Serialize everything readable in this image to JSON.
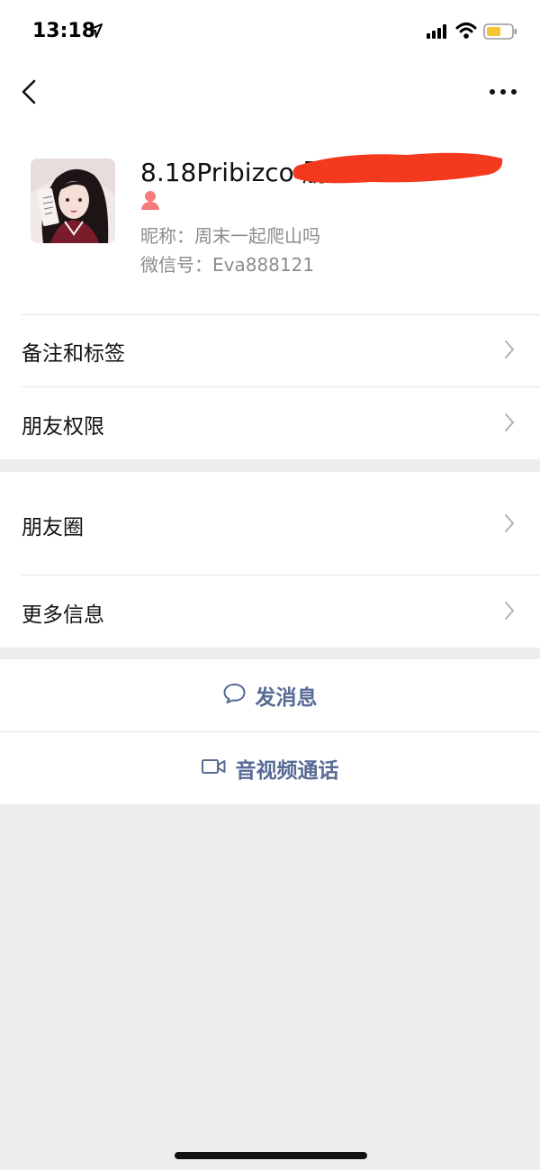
{
  "status_bar": {
    "time": "13:18"
  },
  "profile": {
    "display_name": "8.18Pribizco 朋",
    "nickname": "昵称：周末一起爬山吗",
    "wechat_id": "微信号：Eva888121"
  },
  "menu": {
    "remarks_tags": "备注和标签",
    "friend_permissions": "朋友权限",
    "moments": "朋友圈",
    "more_info": "更多信息"
  },
  "actions": {
    "send_message": "发消息",
    "av_call": "音视频通话"
  },
  "colors": {
    "link": "#576b95",
    "background": "#ededed",
    "redaction": "#f4391f",
    "gender_female": "#f37b7b"
  }
}
